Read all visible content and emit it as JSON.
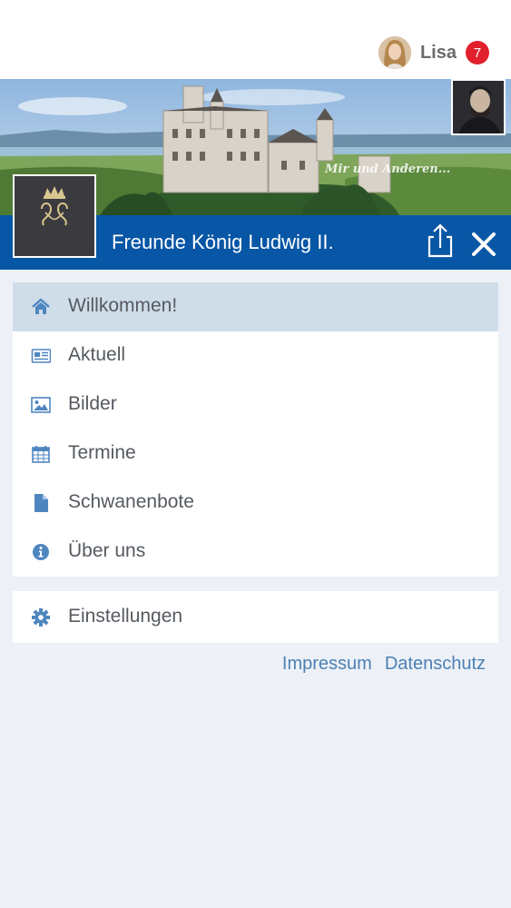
{
  "user": {
    "name": "Lisa",
    "notifications": "7"
  },
  "banner": {
    "caption": "Mir und Anderen..."
  },
  "group": {
    "title": "Freunde König Ludwig II.",
    "logo_text": "Freunde König Ludwig II."
  },
  "menu": {
    "items": [
      {
        "label": "Willkommen!",
        "icon": "home-icon",
        "active": true
      },
      {
        "label": "Aktuell",
        "icon": "newspaper-icon"
      },
      {
        "label": "Bilder",
        "icon": "image-icon"
      },
      {
        "label": "Termine",
        "icon": "calendar-icon"
      },
      {
        "label": "Schwanenbote",
        "icon": "document-icon"
      },
      {
        "label": "Über uns",
        "icon": "info-icon"
      }
    ],
    "settings": {
      "label": "Einstellungen",
      "icon": "gear-icon"
    }
  },
  "footer": {
    "impressum": "Impressum",
    "datenschutz": "Datenschutz"
  },
  "colors": {
    "brand_blue": "#0856a6",
    "active_row": "#cfdde9",
    "icon_blue": "#4f86c0",
    "badge_red": "#e2202d"
  }
}
